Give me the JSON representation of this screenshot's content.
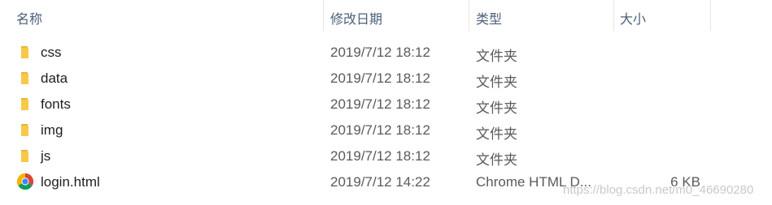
{
  "columns": {
    "name": "名称",
    "date_modified": "修改日期",
    "type": "类型",
    "size": "大小"
  },
  "rows": [
    {
      "name": "css",
      "date": "2019/7/12 18:12",
      "type": "文件夹",
      "size": "",
      "icon": "folder-icon"
    },
    {
      "name": "data",
      "date": "2019/7/12 18:12",
      "type": "文件夹",
      "size": "",
      "icon": "folder-icon"
    },
    {
      "name": "fonts",
      "date": "2019/7/12 18:12",
      "type": "文件夹",
      "size": "",
      "icon": "folder-icon"
    },
    {
      "name": "img",
      "date": "2019/7/12 18:12",
      "type": "文件夹",
      "size": "",
      "icon": "folder-icon"
    },
    {
      "name": "js",
      "date": "2019/7/12 18:12",
      "type": "文件夹",
      "size": "",
      "icon": "folder-icon"
    },
    {
      "name": "login.html",
      "date": "2019/7/12 14:22",
      "type": "Chrome HTML D...",
      "size": "6 KB",
      "icon": "chrome-icon"
    }
  ],
  "watermark": "https://blog.csdn.net/m0_46690280",
  "colors": {
    "header_text": "#4c607a",
    "folder": "#f7c948",
    "chrome_red": "#db4437",
    "chrome_yellow": "#f4b400",
    "chrome_green": "#0f9d58",
    "chrome_blue": "#4285f4"
  }
}
